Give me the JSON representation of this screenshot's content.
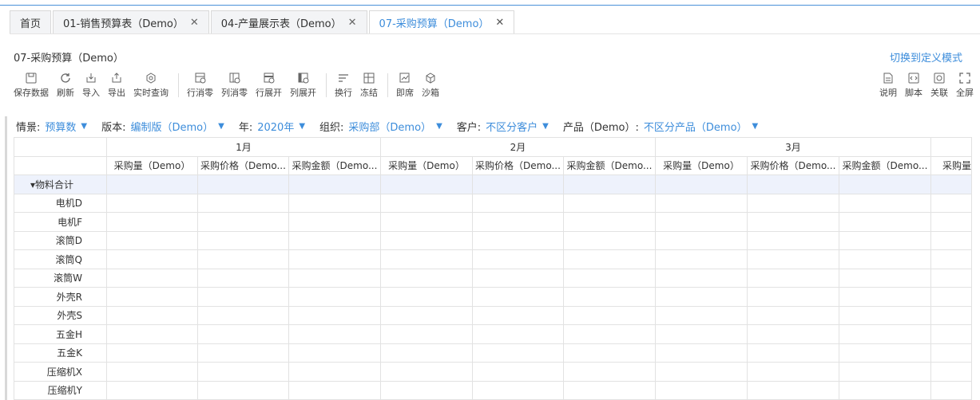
{
  "tabs": [
    {
      "label": "首页",
      "closable": false,
      "active": false
    },
    {
      "label": "01-销售预算表（Demo）",
      "closable": true,
      "active": false
    },
    {
      "label": "04-产量展示表（Demo）",
      "closable": true,
      "active": false
    },
    {
      "label": "07-采购预算（Demo）",
      "closable": true,
      "active": true
    }
  ],
  "close_glyph": "✕",
  "page": {
    "title": "07-采购预算（Demo）",
    "switch_mode": "切换到定义模式"
  },
  "toolbar": {
    "groups": [
      [
        {
          "label": "保存数据",
          "icon": "save-icon"
        },
        {
          "label": "刷新",
          "icon": "refresh-icon"
        },
        {
          "label": "导入",
          "icon": "import-icon"
        },
        {
          "label": "导出",
          "icon": "export-icon"
        },
        {
          "label": "实时查询",
          "icon": "realtime-query-icon"
        }
      ],
      [
        {
          "label": "行消零",
          "icon": "row-zero-icon"
        },
        {
          "label": "列消零",
          "icon": "col-zero-icon"
        },
        {
          "label": "行展开",
          "icon": "row-expand-icon"
        },
        {
          "label": "列展开",
          "icon": "col-expand-icon"
        }
      ],
      [
        {
          "label": "换行",
          "icon": "wrap-icon"
        },
        {
          "label": "冻结",
          "icon": "freeze-icon"
        }
      ],
      [
        {
          "label": "即席",
          "icon": "adhoc-icon"
        },
        {
          "label": "沙箱",
          "icon": "sandbox-icon"
        }
      ]
    ],
    "right": [
      {
        "label": "说明",
        "icon": "document-icon"
      },
      {
        "label": "脚本",
        "icon": "script-icon"
      },
      {
        "label": "关联",
        "icon": "link-icon"
      },
      {
        "label": "全屏",
        "icon": "fullscreen-icon"
      }
    ]
  },
  "filters": [
    {
      "key": "情景:",
      "value": "预算数"
    },
    {
      "key": "版本:",
      "value": "编制版（Demo）"
    },
    {
      "key": "年:",
      "value": "2020年"
    },
    {
      "key": "组织:",
      "value": "采购部（Demo）"
    },
    {
      "key": "客户:",
      "value": "不区分客户"
    },
    {
      "key": "产品（Demo）:",
      "value": "不区分产品（Demo）"
    }
  ],
  "filter_caret": "▼",
  "table": {
    "months": [
      "1月",
      "2月",
      "3月"
    ],
    "columns": [
      "采购量（Demo）",
      "采购价格（Demo...",
      "采购金额（Demo..."
    ],
    "extra_column": "采购量",
    "rows": [
      {
        "label": "▾物料合计",
        "total": true
      },
      {
        "label": "电机D"
      },
      {
        "label": "电机F"
      },
      {
        "label": "滚筒D"
      },
      {
        "label": "滚筒Q"
      },
      {
        "label": "滚筒W"
      },
      {
        "label": "外壳R"
      },
      {
        "label": "外壳S"
      },
      {
        "label": "五金H"
      },
      {
        "label": "五金K"
      },
      {
        "label": "压缩机X"
      },
      {
        "label": "压缩机Y"
      }
    ]
  },
  "colors": {
    "accent": "#3d8ddb",
    "total_row_bg": "#eef2fc"
  }
}
